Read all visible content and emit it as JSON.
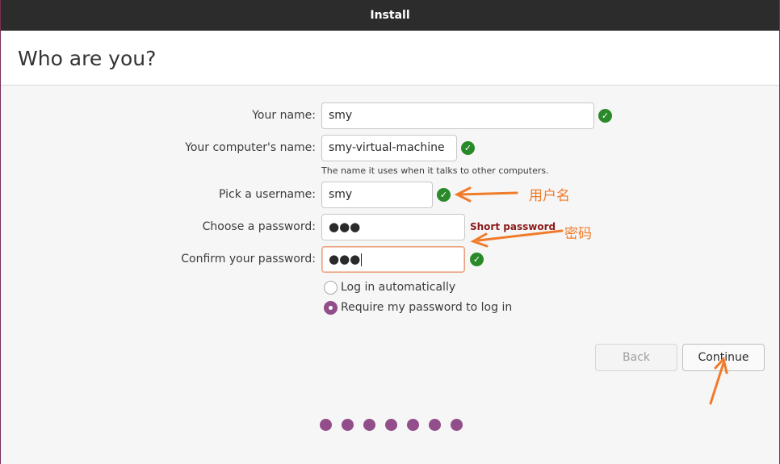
{
  "window": {
    "title": "Install"
  },
  "page": {
    "heading": "Who are you?"
  },
  "form": {
    "name": {
      "label": "Your name:",
      "value": "smy",
      "valid": true
    },
    "computer": {
      "label": "Your computer's name:",
      "value": "smy-virtual-machine",
      "hint": "The name it uses when it talks to other computers.",
      "valid": true
    },
    "username": {
      "label": "Pick a username:",
      "value": "smy",
      "valid": true
    },
    "password": {
      "label": "Choose a password:",
      "value": "●●●",
      "strength": "Short password"
    },
    "confirm": {
      "label": "Confirm your password:",
      "value": "●●●",
      "valid": true
    },
    "login_options": [
      {
        "label": "Log in automatically",
        "selected": false
      },
      {
        "label": "Require my password to log in",
        "selected": true
      }
    ]
  },
  "buttons": {
    "back": "Back",
    "continue": "Continue"
  },
  "progress": {
    "total_steps": 7
  },
  "annotations": {
    "username_note": "用户名",
    "password_note": "密码"
  },
  "colors": {
    "accent": "#924d8b",
    "valid": "#2a8a2a",
    "warning_text": "#8b1a1a",
    "annotation": "#f07b2a"
  }
}
